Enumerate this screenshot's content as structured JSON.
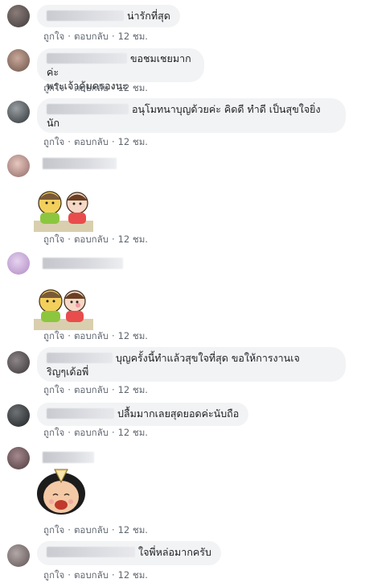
{
  "comments": [
    {
      "text": "น่ารักที่สุด",
      "like": "ถูกใจ",
      "reply": "ตอบกลับ",
      "time": "12 ชม."
    },
    {
      "text": "ขอชมเชยมากค่ะ",
      "text2": "พระเจ้าคุ้มครองนะ",
      "like": "ถูกใจ",
      "reply": "ตอบกลับ",
      "time": "12 ชม."
    },
    {
      "text": "อนุโมทนาบุญด้วยค่ะ คิดดี ทำดี เป็นสุขใจยิ่ง",
      "text2": "นัก",
      "like": "ถูกใจ",
      "reply": "ตอบกลับ",
      "time": "12 ชม."
    },
    {
      "sticker": "couple-hand-sticker",
      "like": "ถูกใจ",
      "reply": "ตอบกลับ",
      "time": "12 ชม."
    },
    {
      "sticker": "couple-cheek-sticker",
      "like": "ถูกใจ",
      "reply": "ตอบกลับ",
      "time": "12 ชม."
    },
    {
      "text": "บุญครั้งนี้ทำแล้วสุขใจที่สุด ขอให้การงานเจ",
      "text2": "ริญๆเด้อพี่",
      "like": "ถูกใจ",
      "reply": "ตอบกลับ",
      "time": "12 ชม."
    },
    {
      "text": "ปลื้มมากเลยสุดยอดค่ะนับถือ",
      "like": "ถูกใจ",
      "reply": "ตอบกลับ",
      "time": "12 ชม."
    },
    {
      "sticker": "wai-girl-sticker",
      "like": "ถูกใจ",
      "reply": "ตอบกลับ",
      "time": "12 ชม."
    },
    {
      "text": "ใจพี่หล่อมากครับ",
      "like": "ถูกใจ",
      "reply": "ตอบกลับ",
      "time": "12 ชม."
    }
  ],
  "colors": {
    "bubble": "#f2f3f5",
    "meta": "#606770",
    "text": "#1c1e21"
  }
}
